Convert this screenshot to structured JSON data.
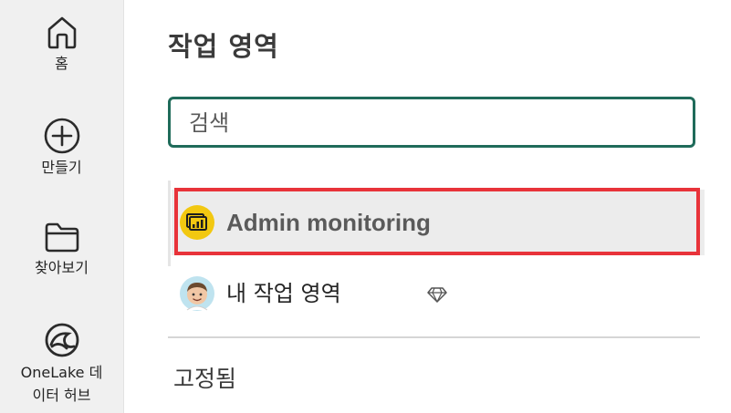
{
  "rail": {
    "items": [
      {
        "label": "홈",
        "icon": "home-icon"
      },
      {
        "label": "만들기",
        "icon": "plus-circle-icon"
      },
      {
        "label": "찾아보기",
        "icon": "folder-icon"
      },
      {
        "label": "OneLake 데이터 허브",
        "label_line1": "OneLake 데",
        "label_line2": "이터 허브",
        "icon": "onelake-icon"
      }
    ]
  },
  "panel": {
    "title": "작업 영역",
    "search": {
      "placeholder": "검색",
      "value": ""
    },
    "workspaces": [
      {
        "label": "Admin monitoring",
        "icon": "admin-monitoring-icon",
        "selected": true
      },
      {
        "label": "내 작업 영역",
        "icon": "avatar",
        "badge_icon": "diamond-icon"
      }
    ],
    "pinned_heading": "고정됨"
  },
  "colors": {
    "search_border": "#1f6b5a",
    "highlight": "#e8333a",
    "admin_icon_bg": "#f2c811"
  }
}
